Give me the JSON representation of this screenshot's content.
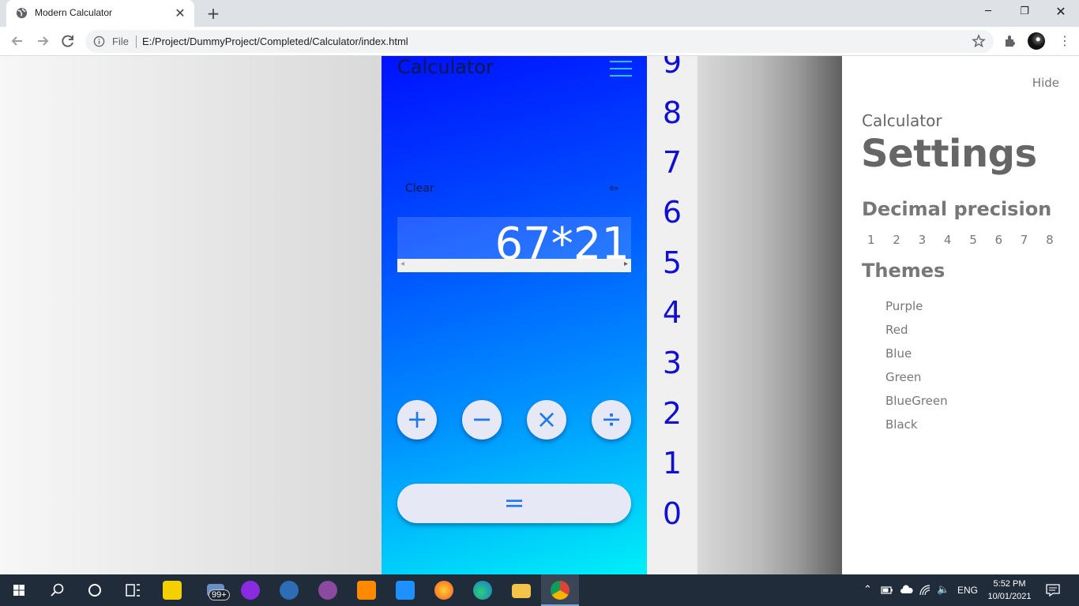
{
  "browser": {
    "tab_title": "Modern Calculator",
    "address_scheme": "File",
    "address_url": "E:/Project/DummyProject/Completed/Calculator/index.html"
  },
  "calculator": {
    "title": "Calculator",
    "clear_label": "Clear",
    "backspace_symbol": "⇦",
    "display_value": "67*21",
    "operators": [
      "+",
      "−",
      "×",
      "÷"
    ],
    "equals_label": "=",
    "digits": [
      "9",
      "8",
      "7",
      "6",
      "5",
      "4",
      "3",
      "2",
      "1",
      "0"
    ]
  },
  "settings": {
    "hide_label": "Hide",
    "subtitle": "Calculator",
    "title": "Settings",
    "decimal_precision_label": "Decimal precision",
    "precision_options": [
      "1",
      "2",
      "3",
      "4",
      "5",
      "6",
      "7",
      "8"
    ],
    "themes_label": "Themes",
    "themes": [
      "Purple",
      "Red",
      "Blue",
      "Green",
      "BlueGreen",
      "Black"
    ]
  },
  "taskbar": {
    "badge_count": "99+",
    "language": "ENG",
    "time": "5:52 PM",
    "date": "10/01/2021"
  },
  "colors": {
    "calc_gradient_start": "#0010ff",
    "calc_gradient_end": "#00f0f8",
    "digit_color": "#1010d0",
    "button_bg": "#e6e8f6",
    "button_icon": "#1e78e8"
  }
}
